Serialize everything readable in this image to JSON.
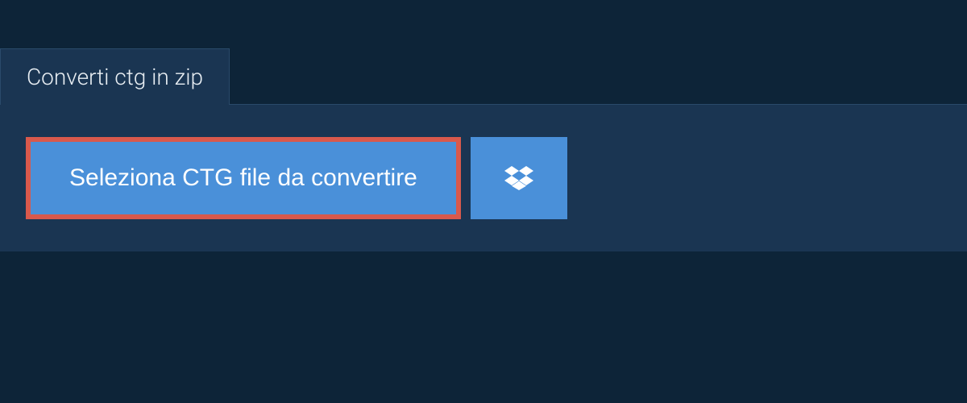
{
  "tab": {
    "label": "Converti ctg in zip"
  },
  "buttons": {
    "select_file": "Seleziona CTG file da convertire"
  }
}
